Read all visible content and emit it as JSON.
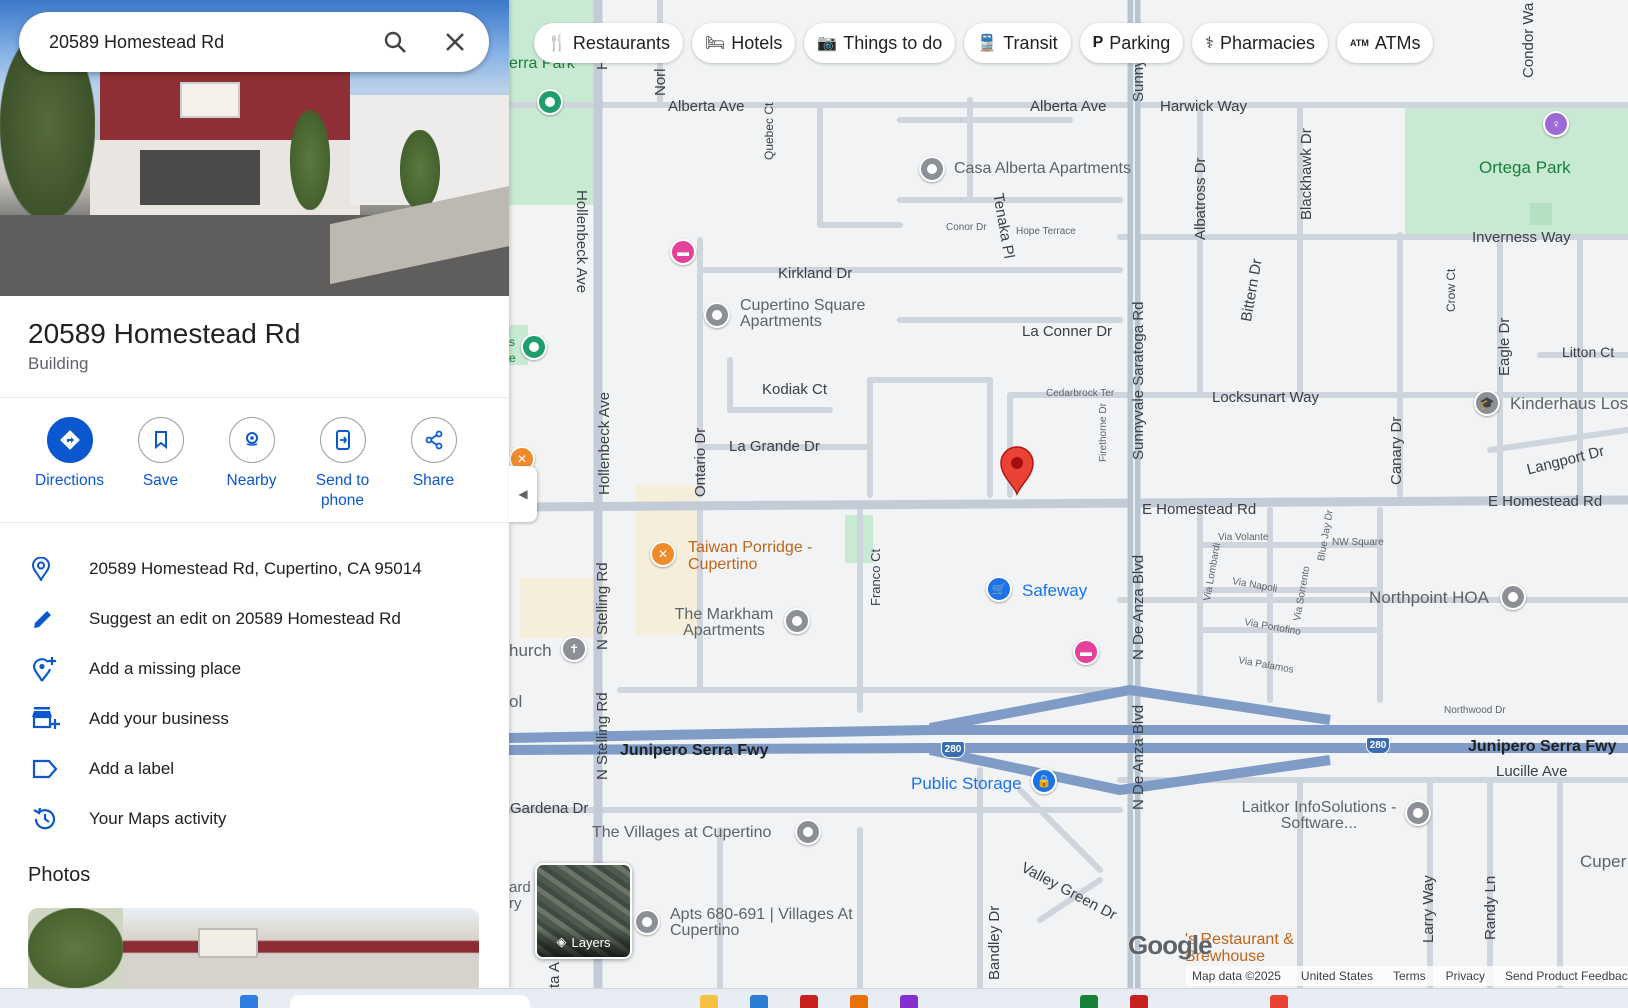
{
  "search": {
    "query": "20589 Homestead Rd"
  },
  "place": {
    "title": "20589 Homestead Rd",
    "type": "Building"
  },
  "actions": [
    {
      "label": "Directions"
    },
    {
      "label": "Save"
    },
    {
      "label": "Nearby"
    },
    {
      "label": "Send to phone"
    },
    {
      "label": "Share"
    }
  ],
  "info": [
    {
      "icon": "location-pin-icon",
      "text": "20589 Homestead Rd, Cupertino, CA 95014"
    },
    {
      "icon": "pencil-icon",
      "text": "Suggest an edit on 20589 Homestead Rd"
    },
    {
      "icon": "add-place-icon",
      "text": "Add a missing place"
    },
    {
      "icon": "add-business-icon",
      "text": "Add your business"
    },
    {
      "icon": "label-icon",
      "text": "Add a label"
    },
    {
      "icon": "history-icon",
      "text": "Your Maps activity"
    }
  ],
  "photos_heading": "Photos",
  "chips": [
    {
      "icon": "fork-knife-icon",
      "label": "Restaurants"
    },
    {
      "icon": "bed-icon",
      "label": "Hotels"
    },
    {
      "icon": "camera-icon",
      "label": "Things to do"
    },
    {
      "icon": "train-icon",
      "label": "Transit"
    },
    {
      "icon": "parking-icon",
      "label": "Parking"
    },
    {
      "icon": "pharmacy-icon",
      "label": "Pharmacies"
    },
    {
      "icon": "atm-icon",
      "label": "ATMs"
    }
  ],
  "map": {
    "streets": {
      "alberta1": "Alberta Ave",
      "alberta2": "Alberta Ave",
      "harwick": "Harwick Way",
      "kirkland": "Kirkland Dr",
      "laconner": "La Conner Dr",
      "kodiak": "Kodiak Ct",
      "lagrande": "La Grande Dr",
      "locksunart": "Locksunart Way",
      "inverness": "Inverness Way",
      "ehomestead1": "E Homestead Rd",
      "ehomestead2": "E Homestead Rd",
      "junipero1": "Junipero Serra Fwy",
      "junipero2": "Junipero Serra Fwy",
      "lucille": "Lucille Ave",
      "gardena": "Gardena Dr",
      "valleygreen": "Valley Green Dr",
      "litton": "Litton Ct",
      "langport": "Langport Dr",
      "hollenbeck1": "Hollenbeck Ave",
      "hollenbeck2": "Hollenbeck Ave",
      "hollenbeck_top": "Holle",
      "nstelling1": "N Stelling Rd",
      "nstelling2": "N Stelling Rd",
      "ontario": "Ontario Dr",
      "quebec": "Quebec Ct",
      "tenaka": "Tenaka Pl",
      "sunnyvale": "Sunnyvale Saratoga Rd",
      "sunny_top": "Sunny",
      "ndeanza1": "N De Anza Blvd",
      "ndeanza2": "N De Anza Blvd",
      "albatross": "Albatross Dr",
      "blackhawk": "Blackhawk Dr",
      "bittern": "Bittern Dr",
      "canary": "Canary Dr",
      "crow": "Crow Ct",
      "eagle": "Eagle Dr",
      "franco": "Franco Ct",
      "bandley": "Bandley Dr",
      "larry": "Larry Way",
      "randy": "Randy Ln",
      "condor": "Condor Wa",
      "norl": "Norl",
      "conor": "Conor Dr",
      "hope": "Hope Terrace",
      "cedarbrock": "Cedarbrock Ter",
      "firethorne": "Firethorne Dr",
      "viavolante": "Via Volante",
      "nwsquare": "NW Square",
      "vialombardi": "Via Lombardi",
      "viasorrento": "Via Sorrento",
      "bluejay": "Blue Jay Dr",
      "vianapoli": "Via Napoli",
      "viaportofino": "Via Portofino",
      "viapalamos": "Via Palamos",
      "northwood": "Northwood Dr"
    },
    "places": {
      "casa_alberta": "Casa Alberta Apartments",
      "cupertino_square": "Cupertino Square Apartments",
      "ortega": "Ortega Park",
      "kinderhaus": "Kinderhaus Los",
      "taiwan_porridge": "Taiwan Porridge - Cupertino",
      "safeway": "Safeway",
      "markham": "The Markham Apartments",
      "northpoint": "Northpoint HOA",
      "church": "hurch",
      "ol": "ol",
      "public_storage": "Public Storage",
      "laitkor": "Laitkor InfoSolutions - Software...",
      "villages": "The Villages at Cupertino",
      "apts680": "Apts 680-691 | Villages At Cupertino",
      "cuper": "Cuper",
      "brewhouse": "'s Restaurant & Brewhouse",
      "erra_park": "erra Park",
      "s_e": "s e",
      "ard_ry": "ard ry",
      "ta_a": "ta A"
    },
    "shields": {
      "i280a": "280",
      "i280b": "280"
    },
    "layers_label": "Layers",
    "logo": "Google",
    "attribution": [
      "Map data ©2025",
      "United States",
      "Terms",
      "Privacy",
      "Send Product Feedback"
    ]
  },
  "colors": {
    "accent": "#0b57d0",
    "pin_red": "#ea4335",
    "park": "#c5ecd4",
    "freeway": "#7e9cc6"
  }
}
